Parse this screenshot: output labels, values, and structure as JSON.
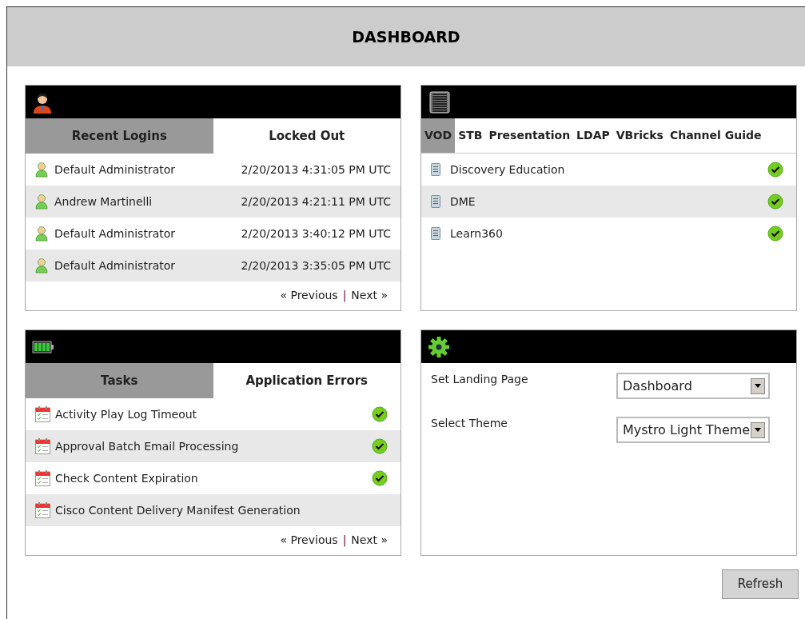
{
  "title": "DASHBOARD",
  "logins": {
    "tabs": [
      {
        "label": "Recent Logins",
        "selected": true
      },
      {
        "label": "Locked Out",
        "selected": false
      }
    ],
    "rows": [
      {
        "name": "Default Administrator",
        "time": "2/20/2013 4:31:05 PM UTC"
      },
      {
        "name": "Andrew Martinelli",
        "time": "2/20/2013 4:21:11 PM UTC"
      },
      {
        "name": "Default Administrator",
        "time": "2/20/2013 3:40:12 PM UTC"
      },
      {
        "name": "Default Administrator",
        "time": "2/20/2013 3:35:05 PM UTC"
      }
    ],
    "pager": {
      "previous": "« Previous",
      "separator": "|",
      "next": "Next »"
    }
  },
  "services": {
    "tabs": [
      {
        "label": "VOD",
        "selected": true
      },
      {
        "label": "STB",
        "selected": false
      },
      {
        "label": "Presentation",
        "selected": false
      },
      {
        "label": "LDAP",
        "selected": false
      },
      {
        "label": "VBricks",
        "selected": false
      },
      {
        "label": "Channel Guide",
        "selected": false
      }
    ],
    "rows": [
      {
        "name": "Discovery Education",
        "ok": true
      },
      {
        "name": "DME",
        "ok": true
      },
      {
        "name": "Learn360",
        "ok": true
      }
    ]
  },
  "tasks": {
    "tabs": [
      {
        "label": "Tasks",
        "selected": true
      },
      {
        "label": "Application Errors",
        "selected": false
      }
    ],
    "rows": [
      {
        "name": "Activity Play Log Timeout",
        "ok": true
      },
      {
        "name": "Approval Batch Email Processing",
        "ok": true
      },
      {
        "name": "Check Content Expiration",
        "ok": true
      },
      {
        "name": "Cisco Content Delivery Manifest Generation",
        "ok": false
      }
    ],
    "pager": {
      "previous": "« Previous",
      "separator": "|",
      "next": "Next »"
    }
  },
  "settings": {
    "fields": [
      {
        "label": "Set Landing Page",
        "value": "Dashboard"
      },
      {
        "label": "Select Theme",
        "value": "Mystro Light Theme"
      }
    ]
  },
  "refresh": "Refresh"
}
